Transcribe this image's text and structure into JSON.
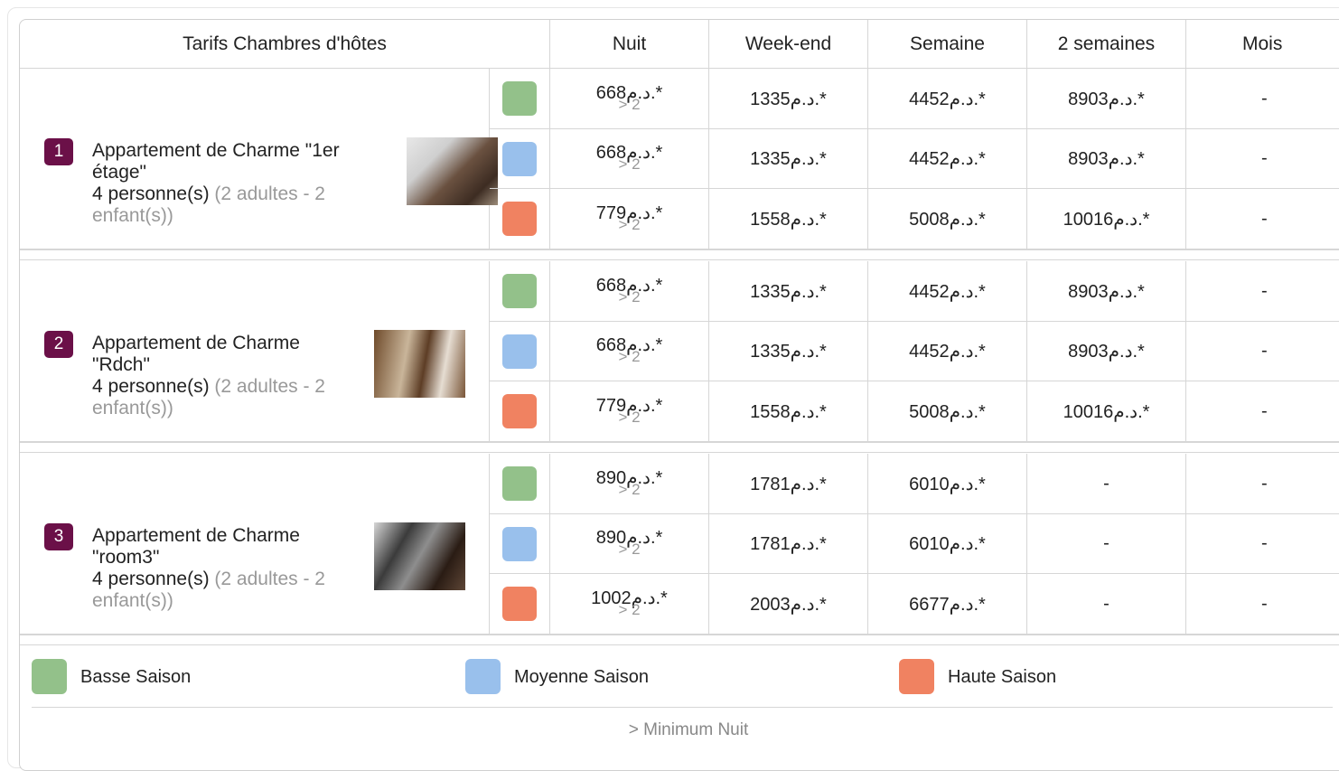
{
  "header": {
    "title": "Tarifs Chambres d'hôtes",
    "cols": [
      "Nuit",
      "Week-end",
      "Semaine",
      "2 semaines",
      "Mois"
    ]
  },
  "colors": {
    "basse": "#93c18a",
    "moyenne": "#99c0ec",
    "haute": "#f08261",
    "badge": "#6b1048"
  },
  "rooms": [
    {
      "num": "1",
      "name": "Appartement de Charme \"1er étage\"",
      "persons": "4 personne(s)",
      "detail": "(2 adultes - 2 enfant(s))",
      "rows": [
        {
          "season": "basse",
          "nuit": "668د.م.*",
          "min": "> 2",
          "weekend": "1335د.م.*",
          "semaine": "4452د.م.*",
          "deux": "8903د.م.*",
          "mois": "-"
        },
        {
          "season": "moyenne",
          "nuit": "668د.م.*",
          "min": "> 2",
          "weekend": "1335د.م.*",
          "semaine": "4452د.م.*",
          "deux": "8903د.م.*",
          "mois": "-"
        },
        {
          "season": "haute",
          "nuit": "779د.م.*",
          "min": "> 2",
          "weekend": "1558د.م.*",
          "semaine": "5008د.م.*",
          "deux": "10016د.م.*",
          "mois": "-"
        }
      ]
    },
    {
      "num": "2",
      "name": "Appartement de Charme \"Rdch\"",
      "persons": "4 personne(s)",
      "detail": "(2 adultes - 2 enfant(s))",
      "rows": [
        {
          "season": "basse",
          "nuit": "668د.م.*",
          "min": "> 2",
          "weekend": "1335د.م.*",
          "semaine": "4452د.م.*",
          "deux": "8903د.م.*",
          "mois": "-"
        },
        {
          "season": "moyenne",
          "nuit": "668د.م.*",
          "min": "> 2",
          "weekend": "1335د.م.*",
          "semaine": "4452د.م.*",
          "deux": "8903د.م.*",
          "mois": "-"
        },
        {
          "season": "haute",
          "nuit": "779د.م.*",
          "min": "> 2",
          "weekend": "1558د.م.*",
          "semaine": "5008د.م.*",
          "deux": "10016د.م.*",
          "mois": "-"
        }
      ]
    },
    {
      "num": "3",
      "name": "Appartement de Charme \"room3\"",
      "persons": "4 personne(s)",
      "detail": "(2 adultes - 2 enfant(s))",
      "rows": [
        {
          "season": "basse",
          "nuit": "890د.م.*",
          "min": "> 2",
          "weekend": "1781د.م.*",
          "semaine": "6010د.م.*",
          "deux": "-",
          "mois": "-"
        },
        {
          "season": "moyenne",
          "nuit": "890د.م.*",
          "min": "> 2",
          "weekend": "1781د.م.*",
          "semaine": "6010د.م.*",
          "deux": "-",
          "mois": "-"
        },
        {
          "season": "haute",
          "nuit": "1002د.م.*",
          "min": "> 2",
          "weekend": "2003د.م.*",
          "semaine": "6677د.م.*",
          "deux": "-",
          "mois": "-"
        }
      ]
    }
  ],
  "legend": [
    {
      "key": "basse",
      "label": "Basse Saison"
    },
    {
      "key": "moyenne",
      "label": "Moyenne Saison"
    },
    {
      "key": "haute",
      "label": "Haute Saison"
    }
  ],
  "footer": "> Minimum Nuit"
}
